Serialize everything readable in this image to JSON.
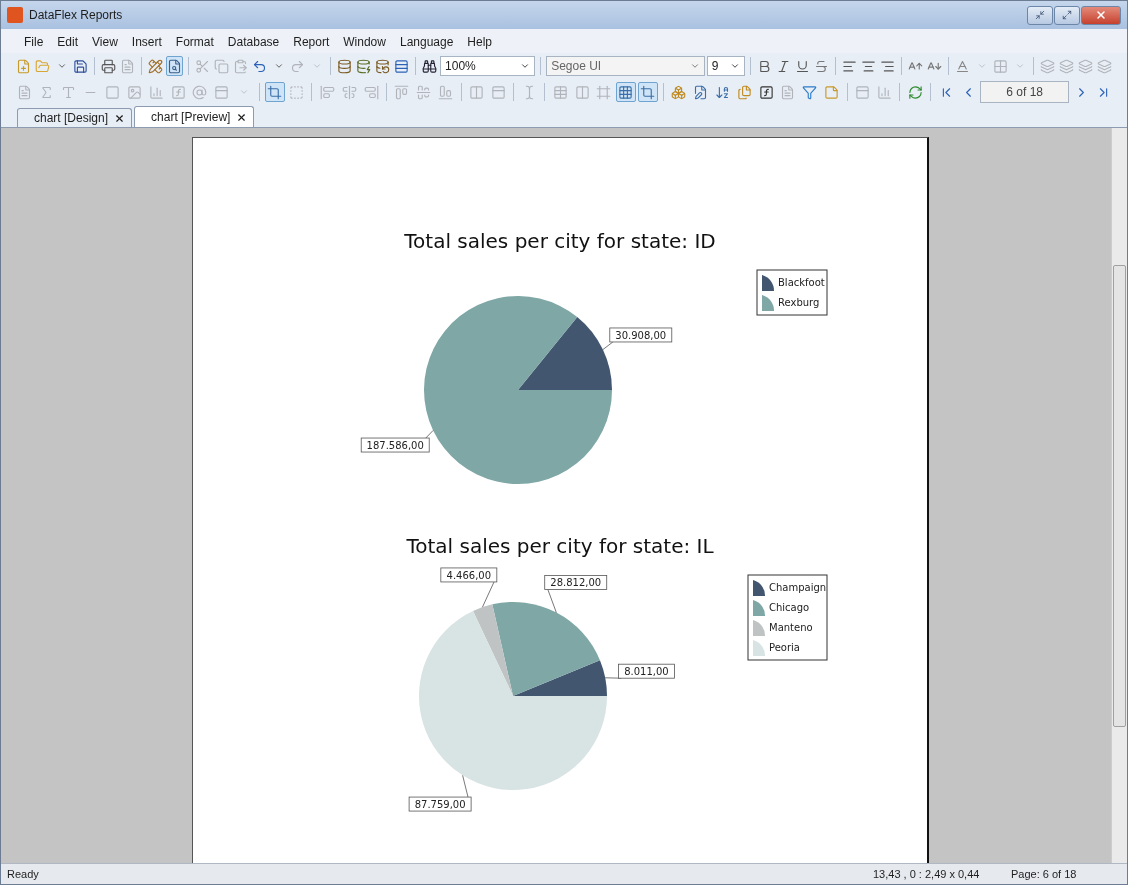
{
  "window": {
    "title": "DataFlex Reports"
  },
  "menu": [
    "File",
    "Edit",
    "View",
    "Insert",
    "Format",
    "Database",
    "Report",
    "Window",
    "Language",
    "Help"
  ],
  "toolbar": {
    "zoom": "100%",
    "font": "Segoe UI",
    "font_size": "9",
    "page": "6 of 18"
  },
  "tabs": [
    {
      "label": "chart [Design]",
      "selected": false
    },
    {
      "label": "chart [Preview]",
      "selected": true
    }
  ],
  "charts": [
    {
      "chart_data": {
        "type": "pie",
        "title": "Total sales per city for state: ID",
        "categories": [
          "Blackfoot",
          "Rexburg"
        ],
        "values": [
          30908,
          187586
        ],
        "value_labels": [
          "30.908,00",
          "187.586,00"
        ],
        "colors": [
          "#425670",
          "#7ea7a5"
        ],
        "legend": "right"
      }
    },
    {
      "chart_data": {
        "type": "pie",
        "title": "Total sales per city for state: IL",
        "categories": [
          "Champaign",
          "Chicago",
          "Manteno",
          "Peoria"
        ],
        "values": [
          8011,
          28812,
          4466,
          87759
        ],
        "value_labels": [
          "8.011,00",
          "28.812,00",
          "4.466,00",
          "87.759,00"
        ],
        "colors": [
          "#425670",
          "#7ea7a5",
          "#bfc3c3",
          "#d8e3e3"
        ],
        "legend": "right"
      }
    }
  ],
  "status_bar": {
    "message": "Ready",
    "position": "13,43 , 0 : 2,49 x 0,44",
    "page": "Page: 6 of 18"
  }
}
